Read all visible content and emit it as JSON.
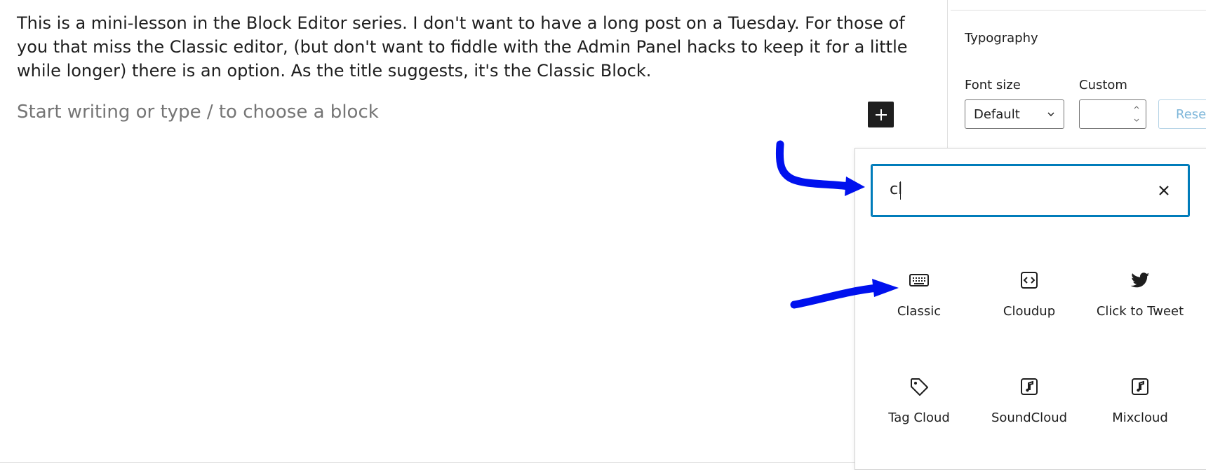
{
  "editor": {
    "paragraph": "This is a mini-lesson in the Block Editor series. I don't want to have a long post on a Tuesday. For those of you that miss the Classic editor, (but don't want to fiddle with the Admin Panel hacks to keep it for a little while longer) there is an option. As the title suggests, it's the Classic Block.",
    "placeholder": "Start writing or type / to choose a block",
    "add_block_icon": "plus-icon"
  },
  "sidebar": {
    "typography_title": "Typography",
    "font_size_label": "Font size",
    "custom_label": "Custom",
    "font_size_value": "Default",
    "custom_value": "",
    "reset_label": "Reset"
  },
  "inserter": {
    "search_value": "cl",
    "clear_icon": "close-icon",
    "blocks": [
      {
        "label": "Classic",
        "icon": "keyboard-icon"
      },
      {
        "label": "Cloudup",
        "icon": "code-embed-icon"
      },
      {
        "label": "Click to Tweet",
        "icon": "twitter-icon"
      },
      {
        "label": "Tag Cloud",
        "icon": "tag-icon"
      },
      {
        "label": "SoundCloud",
        "icon": "audio-icon"
      },
      {
        "label": "Mixcloud",
        "icon": "audio-icon"
      }
    ]
  },
  "colors": {
    "accent": "#007cba",
    "annotation": "#0011ee",
    "text": "#1e1e1e",
    "placeholder": "#757575"
  }
}
